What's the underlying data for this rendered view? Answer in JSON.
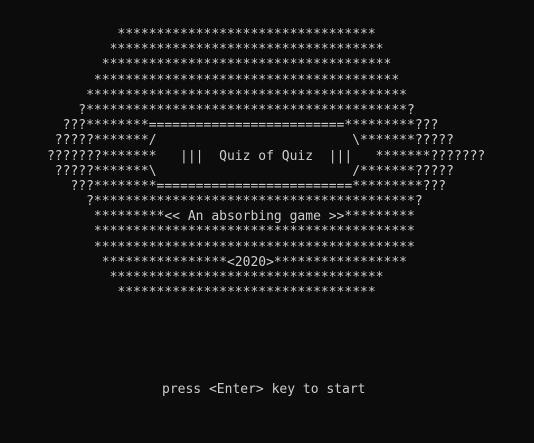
{
  "window": {
    "background": "#0c0c0c",
    "foreground": "#cccccc"
  },
  "banner": {
    "lines": [
      "               *********************************",
      "              ***********************************",
      "             *************************************",
      "            ***************************************",
      "           *****************************************",
      "          ?*****************************************?",
      "        ???********=========================*********???",
      "       ?????*******/                         \\*******?????",
      "      ???????*******   |||  Quiz of Quiz  |||   *******???????",
      "       ?????*******\\                         /*******?????",
      "         ???********=========================*********???",
      "           ?*****************************************?",
      "            *********<< An absorbing game >>*********",
      "            *****************************************",
      "            *****************************************",
      "             ****************<2020>*****************",
      "              ***********************************",
      "               *********************************"
    ]
  },
  "prompt": {
    "text": "press <Enter> key to start"
  }
}
